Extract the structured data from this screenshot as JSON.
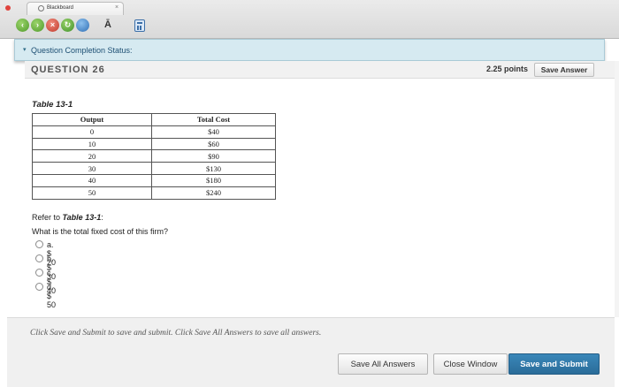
{
  "browser": {
    "tab_title": "Blackboard",
    "tab_close": "×",
    "toolbar": {
      "back_glyph": "‹",
      "forward_glyph": "›",
      "stop_glyph": "×",
      "refresh_glyph": "↻",
      "font_glyph": "Ā"
    }
  },
  "status": {
    "chevron": "▾",
    "label": "Question Completion Status:"
  },
  "question": {
    "title": "QUESTION 26",
    "points": "2.25 points",
    "save_answer_label": "Save Answer"
  },
  "table": {
    "caption": "Table 13-1",
    "headers": [
      "Output",
      "Total Cost"
    ],
    "rows": [
      [
        "0",
        "$40"
      ],
      [
        "10",
        "$60"
      ],
      [
        "20",
        "$90"
      ],
      [
        "30",
        "$130"
      ],
      [
        "40",
        "$180"
      ],
      [
        "50",
        "$240"
      ]
    ]
  },
  "prompt": {
    "refer_prefix": "Refer to ",
    "refer_table": "Table 13-1",
    "refer_suffix": ":",
    "text": "What is the total fixed cost of this firm?"
  },
  "options": [
    "a. $ 20",
    "b. $ 30",
    "c. $ 40",
    "d. $ 50"
  ],
  "footer": {
    "message": "Click Save and Submit to save and submit. Click Save All Answers to save all answers.",
    "save_all_label": "Save All Answers",
    "close_window_label": "Close Window",
    "save_submit_label": "Save and Submit"
  },
  "colors": {
    "status_bg": "#d6eaf1",
    "submit_bg": "#2f76a6"
  }
}
